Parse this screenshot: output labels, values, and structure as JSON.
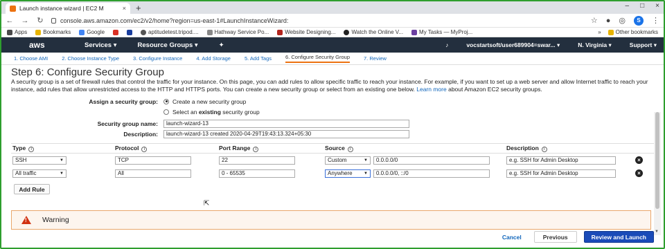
{
  "browser": {
    "tab_title": "Launch instance wizard | EC2 M",
    "tab_close": "×",
    "new_tab": "+",
    "url": "console.aws.amazon.com/ec2/v2/home?region=us-east-1#LaunchInstanceWizard:",
    "profile_initial": "S",
    "window_controls": [
      "–",
      "□",
      "×"
    ]
  },
  "bookmarks": {
    "items": [
      {
        "label": "Apps",
        "color": "#4a4a4a"
      },
      {
        "label": "Bookmarks",
        "color": "#e8b400"
      },
      {
        "label": "Google",
        "color": "#4285f4"
      },
      {
        "label": "",
        "color": "#d93025"
      },
      {
        "label": "",
        "color": "#1a3e9e"
      },
      {
        "label": "aptitudetest.tripod....",
        "color": "#555555"
      },
      {
        "label": "Hathway Service Po...",
        "color": "#888888"
      },
      {
        "label": "Website Designing...",
        "color": "#b3261e"
      },
      {
        "label": "Watch the Online V...",
        "color": "#222222"
      },
      {
        "label": "My Tasks — MyProj...",
        "color": "#6b3fa0"
      }
    ],
    "overflow": "»",
    "other": "Other bookmarks"
  },
  "aws_nav": {
    "logo": "aws",
    "services": "Services",
    "resource_groups": "Resource Groups",
    "pin_icon": "✦",
    "bell_icon": "🔔",
    "account": "vocstartsoft/user689904=swar...",
    "region": "N. Virginia",
    "support": "Support"
  },
  "steps": [
    {
      "label": "1. Choose AMI",
      "active": false
    },
    {
      "label": "2. Choose Instance Type",
      "active": false
    },
    {
      "label": "3. Configure Instance",
      "active": false
    },
    {
      "label": "4. Add Storage",
      "active": false
    },
    {
      "label": "5. Add Tags",
      "active": false
    },
    {
      "label": "6. Configure Security Group",
      "active": true
    },
    {
      "label": "7. Review",
      "active": false
    }
  ],
  "page": {
    "title": "Step 6: Configure Security Group",
    "intro": "A security group is a set of firewall rules that control the traffic for your instance. On this page, you can add rules to allow specific traffic to reach your instance. For example, if you want to set up a web server and allow Internet traffic to reach your instance, add rules that allow unrestricted access to the HTTP and HTTPS ports. You can create a new security group or select from an existing one below.",
    "learn_more": "Learn more",
    "intro_tail": "about Amazon EC2 security groups."
  },
  "form": {
    "assign_label": "Assign a security group:",
    "option_new": "Create a new security group",
    "option_existing_pre": "Select an ",
    "option_existing_bold": "existing",
    "option_existing_post": " security group",
    "name_label": "Security group name:",
    "name_value": "launch-wizard-13",
    "desc_label": "Description:",
    "desc_value": "launch-wizard-13 created 2020-04-29T19:43:13.324+05:30"
  },
  "rules": {
    "headers": {
      "type": "Type",
      "protocol": "Protocol",
      "port": "Port Range",
      "source": "Source",
      "description": "Description"
    },
    "rows": [
      {
        "type": "SSH",
        "protocol": "TCP",
        "port": "22",
        "source_type": "Custom",
        "source_value": "0.0.0.0/0",
        "description": "e.g. SSH for Admin Desktop"
      },
      {
        "type": "All traffic",
        "protocol": "All",
        "port": "0 - 65535",
        "source_type": "Anywhere",
        "source_value": "0.0.0.0/0, ::/0",
        "description": "e.g. SSH for Admin Desktop"
      }
    ],
    "add_rule": "Add Rule"
  },
  "warning": {
    "title": "Warning",
    "icon": "!"
  },
  "footer": {
    "cancel": "Cancel",
    "previous": "Previous",
    "review": "Review and Launch"
  }
}
